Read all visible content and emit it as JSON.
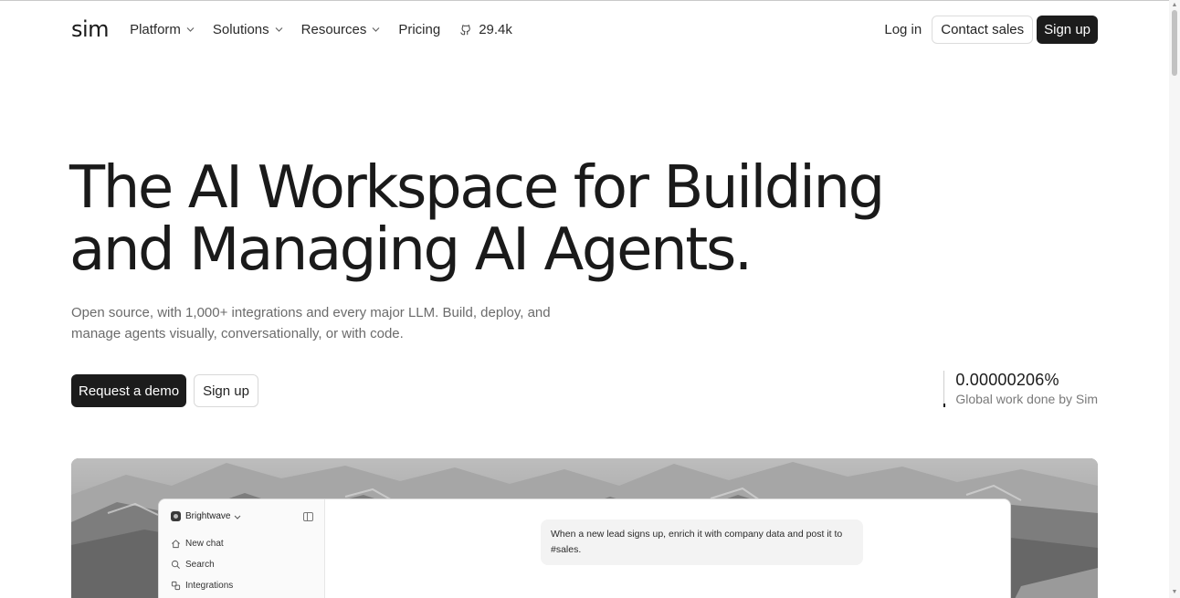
{
  "header": {
    "logo": "sim",
    "nav": [
      {
        "label": "Platform",
        "has_dropdown": true
      },
      {
        "label": "Solutions",
        "has_dropdown": true
      },
      {
        "label": "Resources",
        "has_dropdown": true
      },
      {
        "label": "Pricing",
        "has_dropdown": false
      }
    ],
    "github_stars": "29.4k",
    "github_icon": "github-icon",
    "login_label": "Log in",
    "contact_label": "Contact sales",
    "signup_label": "Sign up"
  },
  "hero": {
    "title_line1": "The AI Workspace for Building",
    "title_line2": "and Managing AI Agents.",
    "subtitle_line1": "Open source, with 1,000+ integrations and every major LLM. Build, deploy, and",
    "subtitle_line2": "manage agents visually, conversationally, or with code.",
    "primary_cta": "Request a demo",
    "secondary_cta": "Sign up"
  },
  "stat": {
    "value": "0.00000206%",
    "label": "Global work done by Sim"
  },
  "preview": {
    "workspace_name": "Brightwave",
    "sidebar_items": [
      {
        "label": "New chat",
        "icon": "home-icon"
      },
      {
        "label": "Search",
        "icon": "search-icon"
      },
      {
        "label": "Integrations",
        "icon": "integrations-icon"
      }
    ],
    "chat_message": "When a new lead signs up, enrich it with company data and post it to #sales."
  },
  "colors": {
    "dark_button": "#1c1c1c",
    "text": "#1a1a1a",
    "muted_text": "#6b6b6b"
  }
}
